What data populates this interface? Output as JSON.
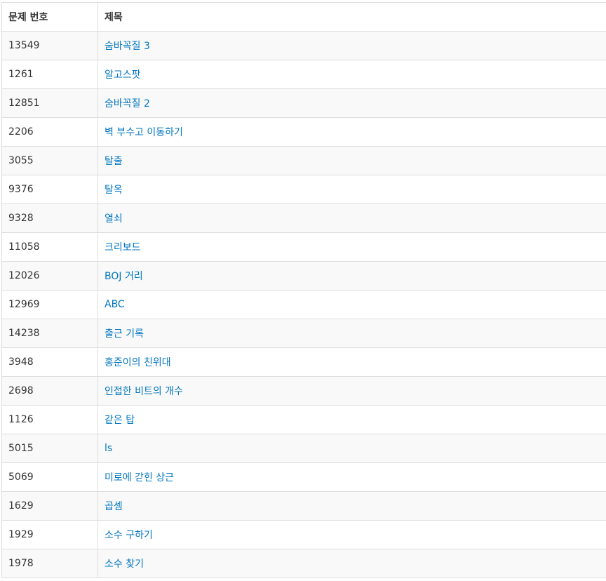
{
  "table": {
    "headers": [
      "문제 번호",
      "제목"
    ],
    "rows": [
      {
        "id": "13549",
        "title": "숨바꼭질 3"
      },
      {
        "id": "1261",
        "title": "알고스팟"
      },
      {
        "id": "12851",
        "title": "숨바꼭질 2"
      },
      {
        "id": "2206",
        "title": "벽 부수고 이동하기"
      },
      {
        "id": "3055",
        "title": "탈출"
      },
      {
        "id": "9376",
        "title": "탈옥"
      },
      {
        "id": "9328",
        "title": "열쇠"
      },
      {
        "id": "11058",
        "title": "크리보드"
      },
      {
        "id": "12026",
        "title": "BOJ 거리"
      },
      {
        "id": "12969",
        "title": "ABC"
      },
      {
        "id": "14238",
        "title": "출근 기록"
      },
      {
        "id": "3948",
        "title": "홍준이의 친위대"
      },
      {
        "id": "2698",
        "title": "인접한 비트의 개수"
      },
      {
        "id": "1126",
        "title": "같은 탑"
      },
      {
        "id": "5015",
        "title": "ls"
      },
      {
        "id": "5069",
        "title": "미로에 갇힌 상근"
      },
      {
        "id": "1629",
        "title": "곱셈"
      },
      {
        "id": "1929",
        "title": "소수 구하기"
      },
      {
        "id": "1978",
        "title": "소수 찾기"
      }
    ]
  },
  "colors": {
    "link": "#0076c0",
    "text": "#333333",
    "border": "#dddddd",
    "stripe": "#f9f9f9"
  }
}
